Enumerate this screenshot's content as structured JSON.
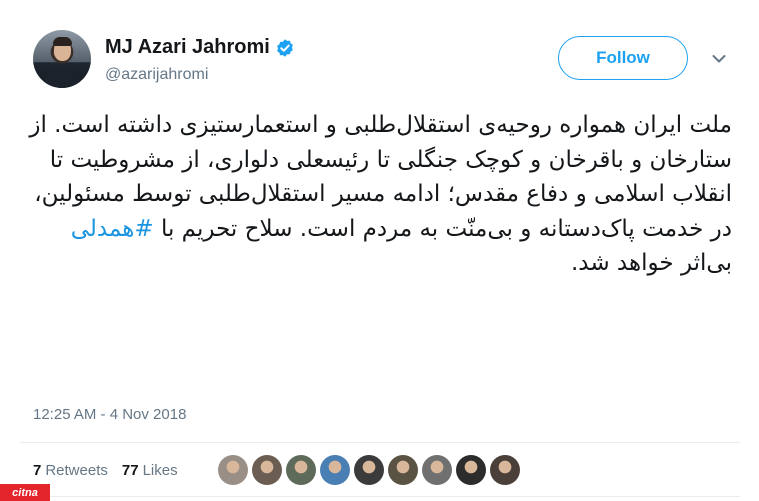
{
  "author": {
    "name": "MJ Azari Jahromi",
    "handle": "@azarijahromi",
    "verified_icon": "verified-badge-icon"
  },
  "follow_button": {
    "label": "Follow"
  },
  "menu_icon": "chevron-down-icon",
  "tweet": {
    "body": "ملت ایران همواره روحیه‌ی استقلال‌طلبی و استعمارستیزی داشته است. از ستارخان و باقرخان و کوچک جنگلی تا رئیسعلی دلواری، از مشروطیت تا انقلاب اسلامی و دفاع مقدس؛ ادامه مسیر استقلال‌طلبی توسط مسئولین، در خدمت پاک‌دستانه و بی‌منّت به مردم است. سلاح تحریم با ",
    "hashtag": "#همدلی",
    "tail": " بی‌اثر خواهد شد."
  },
  "timestamp": "12:25 AM - 4 Nov 2018",
  "stats": {
    "retweets_count": "7",
    "retweets_label": "Retweets",
    "likes_count": "77",
    "likes_label": "Likes"
  },
  "likers_avatar_colors": [
    "#9a8f86",
    "#6b5d52",
    "#5e6a5a",
    "#4a7fb3",
    "#3b3b3b",
    "#5a5243",
    "#707070",
    "#2c2c2c",
    "#4b3f39"
  ],
  "watermark": {
    "text": "citna",
    "color": "#e4252b"
  },
  "colors": {
    "accent": "#1da1f2",
    "hashtag": "#1b95e0",
    "muted": "#657786"
  }
}
